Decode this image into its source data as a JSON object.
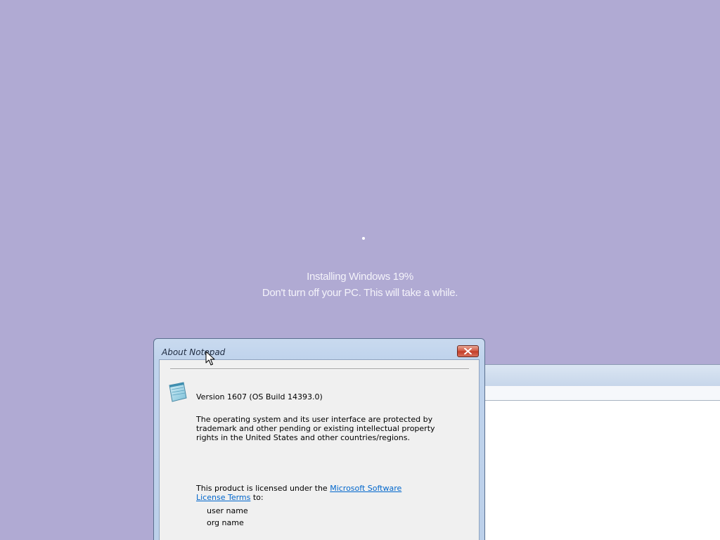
{
  "setup": {
    "progress_line": "Installing Windows  19%",
    "progress_percent": 19,
    "warning_line": "Don't turn off your PC. This will take a while."
  },
  "dialog": {
    "title": "About Notepad",
    "icon": "notepad-icon",
    "close_icon": "close-icon",
    "version": "Version 1607 (OS Build 14393.0)",
    "legal_text": "The  operating system and its user interface are protected by trademark and other pending or existing intellectual property rights in the United States and other countries/regions.",
    "license_prefix": "This product is licensed under the ",
    "license_link": "Microsoft Software License Terms",
    "license_suffix": " to:",
    "user_name": "user name",
    "org_name": "org name"
  },
  "colors": {
    "desktop_background": "#b0aad3",
    "setup_text": "#f4f3fa",
    "link": "#0066cc",
    "close_button": "#c23b26"
  }
}
